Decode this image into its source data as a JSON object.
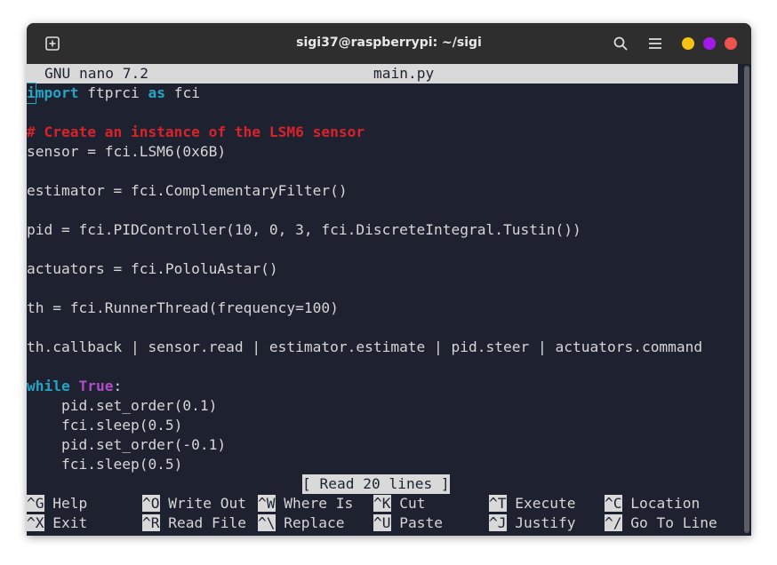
{
  "window": {
    "title": "sigi37@raspberrypi: ~/sigi",
    "colors": {
      "close": "#ef5350",
      "maximize": "#a419e8",
      "minimize": "#f5c211"
    }
  },
  "nano": {
    "version": "GNU nano 7.2",
    "filename": "main.py",
    "status": "[ Read 20 lines ]"
  },
  "code": {
    "l1_import": "import",
    "l1_mod": " ftprci ",
    "l1_as": "as",
    "l1_alias": " fci",
    "comment": "# Create an instance of the LSM6 sensor",
    "l_sensor": "sensor = fci.LSM6(0x6B)",
    "l_estimator": "estimator = fci.ComplementaryFilter()",
    "l_pid": "pid = fci.PIDController(10, 0, 3, fci.DiscreteIntegral.Tustin())",
    "l_actuators": "actuators = fci.PololuAstar()",
    "l_th": "th = fci.RunnerThread(frequency=100)",
    "l_callback": "th.callback | sensor.read | estimator.estimate | pid.steer | actuators.command",
    "l_while": "while",
    "l_true": "True",
    "l_colon": ":",
    "l_b1": "    pid.set_order(0.1)",
    "l_b2": "    fci.sleep(0.5)",
    "l_b3": "    pid.set_order(-0.1)",
    "l_b4": "    fci.sleep(0.5)"
  },
  "shortcuts": [
    {
      "key": "^G",
      "label": " Help"
    },
    {
      "key": "^O",
      "label": " Write Out"
    },
    {
      "key": "^W",
      "label": " Where Is"
    },
    {
      "key": "^K",
      "label": " Cut"
    },
    {
      "key": "^T",
      "label": " Execute"
    },
    {
      "key": "^C",
      "label": " Location"
    },
    {
      "key": "^X",
      "label": " Exit"
    },
    {
      "key": "^R",
      "label": " Read File"
    },
    {
      "key": "^\\",
      "label": " Replace"
    },
    {
      "key": "^U",
      "label": " Paste"
    },
    {
      "key": "^J",
      "label": " Justify"
    },
    {
      "key": "^/",
      "label": " Go To Line"
    }
  ]
}
